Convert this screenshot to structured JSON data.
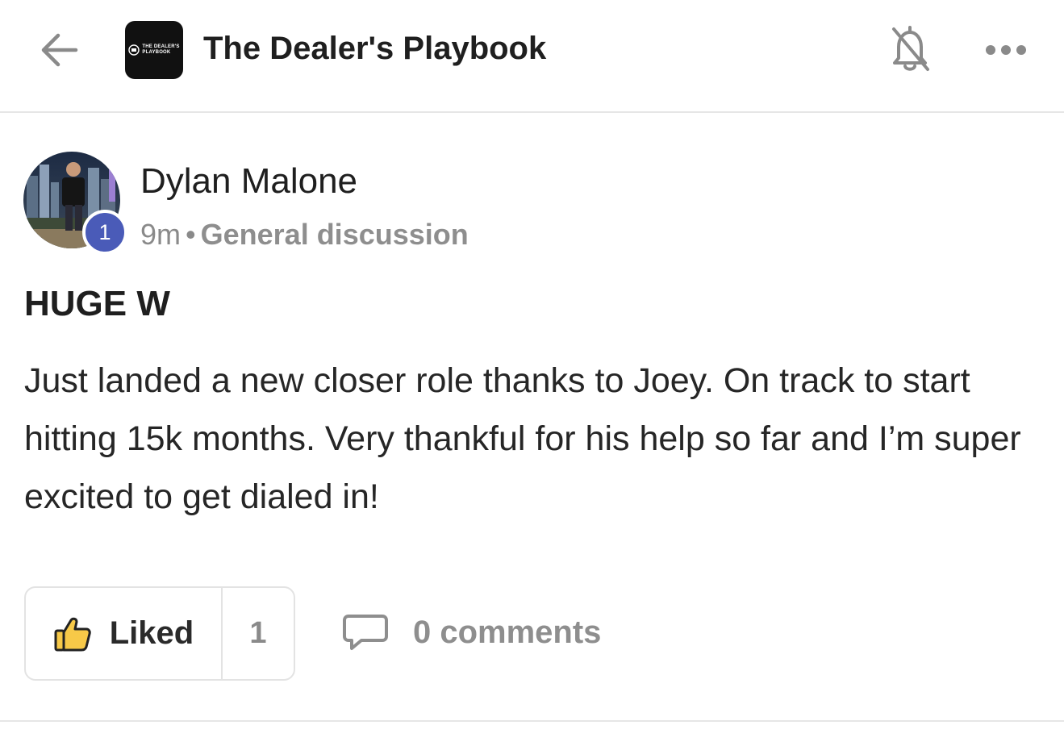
{
  "header": {
    "title": "The Dealer's Playbook",
    "logo_text_line1": "THE DEALER'S",
    "logo_text_line2": "PLAYBOOK",
    "back_icon": "arrow-left-icon",
    "bell_icon": "bell-off-icon",
    "more_icon": "more-horizontal-icon"
  },
  "post": {
    "author": "Dylan Malone",
    "level": "1",
    "time": "9m",
    "separator": "•",
    "category": "General discussion",
    "title": "HUGE W",
    "body": "Just landed a new closer role thanks to Joey. On track to start hitting 15k months. Very thankful for his help so far and I’m super excited to get dialed in!",
    "like_label": "Liked",
    "like_count": "1",
    "comments_label": "0 comments"
  },
  "colors": {
    "level_badge": "#4a5bb8",
    "like_icon_fill": "#f7c948",
    "muted_text": "#8e8e8e"
  }
}
